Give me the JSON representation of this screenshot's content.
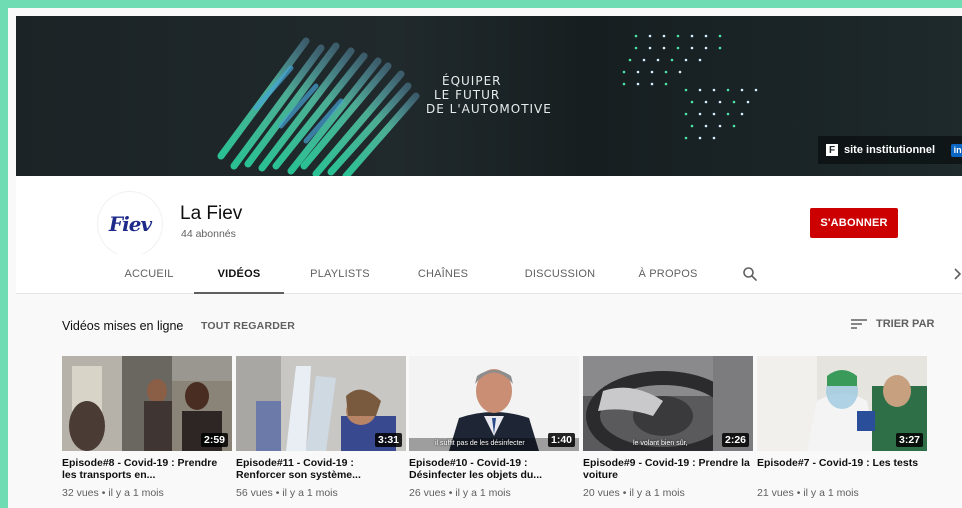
{
  "banner": {
    "tagline": [
      "ÉQUIPER",
      "LE FUTUR",
      "DE L'AUTOMOTIVE"
    ],
    "links": {
      "site_icon": "F",
      "site_label": "site institutionnel",
      "linkedin_icon": "in"
    }
  },
  "channel": {
    "avatar_text": "Fiev",
    "name": "La Fiev",
    "subscribers": "44 abonnés",
    "subscribe_label": "S'ABONNER"
  },
  "tabs": [
    {
      "label": "ACCUEIL",
      "active": false
    },
    {
      "label": "VIDÉOS",
      "active": true
    },
    {
      "label": "PLAYLISTS",
      "active": false
    },
    {
      "label": "CHAÎNES",
      "active": false
    },
    {
      "label": "DISCUSSION",
      "active": false
    },
    {
      "label": "À PROPOS",
      "active": false
    }
  ],
  "shelf": {
    "title": "Vidéos mises en ligne",
    "play_all": "TOUT REGARDER",
    "sort_label": "TRIER PAR"
  },
  "videos": [
    {
      "title": "Episode#8 - Covid-19 : Prendre les transports en...",
      "duration": "2:59",
      "views": "32 vues",
      "age": "il y a 1 mois",
      "caption": ""
    },
    {
      "title": "Episode#11 - Covid-19 : Renforcer son système...",
      "duration": "3:31",
      "views": "56 vues",
      "age": "il y a 1 mois",
      "caption": ""
    },
    {
      "title": "Episode#10 - Covid-19 : Désinfecter les objets du...",
      "duration": "1:40",
      "views": "26 vues",
      "age": "il y a 1 mois",
      "caption": "il suffit pas de les désinfecter"
    },
    {
      "title": "Episode#9 - Covid-19 : Prendre la voiture",
      "duration": "2:26",
      "views": "20 vues",
      "age": "il y a 1 mois",
      "caption": "le volant bien sûr,"
    },
    {
      "title": "Episode#7 - Covid-19 : Les tests",
      "duration": "3:27",
      "views": "21 vues",
      "age": "il y a 1 mois",
      "caption": ""
    }
  ],
  "meta_separator": "•",
  "colors": {
    "frame": "#6fdcb4",
    "subscribe": "#cc0000",
    "banner_bg": "#1b2326",
    "banner_accent": "#4fe3a8"
  },
  "icons": {
    "search": "search-icon",
    "sort": "sort-icon",
    "next": "chevron-right-icon"
  }
}
